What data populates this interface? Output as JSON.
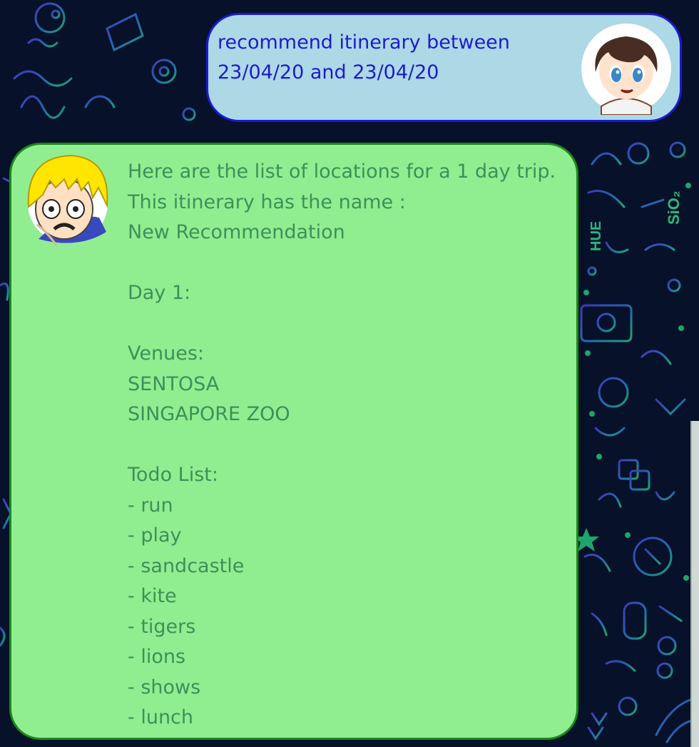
{
  "chat": {
    "user_message": "recommend itinerary between\n23/04/20 and 23/04/20",
    "bot_message": "Here are the list of locations for a 1 day trip.\nThis itinerary has the name :\nNew Recommendation\n\nDay 1:\n\nVenues:\nSENTOSA\nSINGAPORE ZOO\n\nTodo List:\n - run\n - play\n - sandcastle\n - kite\n - tigers\n - lions\n - shows\n - lunch"
  },
  "background_icons": {
    "text_hue": "HUE",
    "text_sio2": "SiO₂"
  },
  "colors": {
    "background": "#07112a",
    "user_bubble": "#add8e6",
    "user_border": "#1a1ad6",
    "user_text": "#1c1ccc",
    "bot_bubble": "#90ee90",
    "bot_border": "#1a8a1a",
    "bot_text": "#3f8f5a"
  }
}
